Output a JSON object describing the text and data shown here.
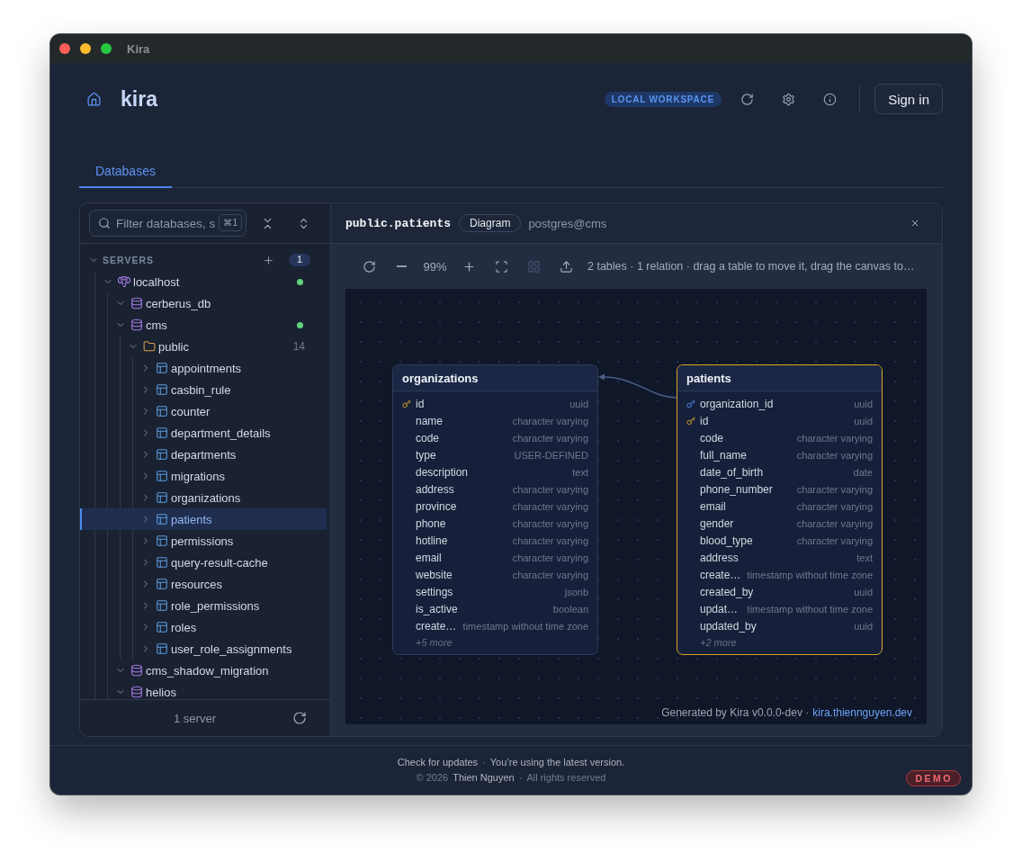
{
  "window": {
    "title": "Kira"
  },
  "header": {
    "brand": "kira",
    "badge": "LOCAL WORKSPACE",
    "sign_in": "Sign in"
  },
  "tabs": [
    {
      "label": "Databases",
      "selected": true
    }
  ],
  "sidebar": {
    "search": {
      "placeholder": "Filter databases, s",
      "shortcut": "⌘1"
    },
    "section": {
      "label": "SERVERS",
      "count": "1",
      "expanded": true
    },
    "tree": [
      {
        "kind": "server",
        "label": "localhost",
        "expanded": true,
        "connected": true,
        "selected": false,
        "children": [
          {
            "kind": "database",
            "label": "cerberus_db",
            "expanded": true,
            "connected": false,
            "selected": false
          },
          {
            "kind": "database",
            "label": "cms",
            "expanded": true,
            "connected": true,
            "selected": false,
            "children": [
              {
                "kind": "schema",
                "label": "public",
                "expanded": true,
                "selected": false,
                "count": "14",
                "children": [
                  {
                    "kind": "table",
                    "label": "appointments",
                    "expanded": false,
                    "selected": false
                  },
                  {
                    "kind": "table",
                    "label": "casbin_rule",
                    "expanded": false,
                    "selected": false
                  },
                  {
                    "kind": "table",
                    "label": "counter",
                    "expanded": false,
                    "selected": false
                  },
                  {
                    "kind": "table",
                    "label": "department_details",
                    "expanded": false,
                    "selected": false
                  },
                  {
                    "kind": "table",
                    "label": "departments",
                    "expanded": false,
                    "selected": false
                  },
                  {
                    "kind": "table",
                    "label": "migrations",
                    "expanded": false,
                    "selected": false
                  },
                  {
                    "kind": "table",
                    "label": "organizations",
                    "expanded": false,
                    "selected": false
                  },
                  {
                    "kind": "table",
                    "label": "patients",
                    "expanded": false,
                    "selected": true
                  },
                  {
                    "kind": "table",
                    "label": "permissions",
                    "expanded": false,
                    "selected": false
                  },
                  {
                    "kind": "table",
                    "label": "query-result-cache",
                    "expanded": false,
                    "selected": false
                  },
                  {
                    "kind": "table",
                    "label": "resources",
                    "expanded": false,
                    "selected": false
                  },
                  {
                    "kind": "table",
                    "label": "role_permissions",
                    "expanded": false,
                    "selected": false
                  },
                  {
                    "kind": "table",
                    "label": "roles",
                    "expanded": false,
                    "selected": false
                  },
                  {
                    "kind": "table",
                    "label": "user_role_assignments",
                    "expanded": false,
                    "selected": false
                  }
                ]
              }
            ]
          },
          {
            "kind": "database",
            "label": "cms_shadow_migration",
            "expanded": true,
            "connected": false,
            "selected": false
          },
          {
            "kind": "database",
            "label": "helios",
            "expanded": true,
            "connected": false,
            "selected": false
          }
        ]
      }
    ],
    "footer": "1 server"
  },
  "editor": {
    "title": "public.patients",
    "mode": "Diagram",
    "connection": "postgres@cms",
    "toolbar": [
      {
        "kind": "refresh",
        "disabled": false
      },
      {
        "kind": "zoom_out",
        "disabled": false
      },
      {
        "kind": "zoom_level",
        "label": "99%"
      },
      {
        "kind": "zoom_in",
        "disabled": false
      },
      {
        "kind": "fit",
        "disabled": false
      },
      {
        "kind": "layout",
        "disabled": true
      },
      {
        "kind": "export",
        "disabled": false
      },
      {
        "kind": "summary",
        "label": "2 tables · 1 relation · drag a table to move it, drag the canvas to…"
      }
    ],
    "diagram": {
      "tables": [
        {
          "name": "organizations",
          "selected": false,
          "columns": [
            {
              "kind": "primary",
              "name": "id",
              "type": "uuid"
            },
            {
              "kind": "plain",
              "name": "name",
              "type": "character varying"
            },
            {
              "kind": "plain",
              "name": "code",
              "type": "character varying"
            },
            {
              "kind": "plain",
              "name": "type",
              "type": "USER-DEFINED"
            },
            {
              "kind": "plain",
              "name": "description",
              "type": "text"
            },
            {
              "kind": "plain",
              "name": "address",
              "type": "character varying"
            },
            {
              "kind": "plain",
              "name": "province",
              "type": "character varying"
            },
            {
              "kind": "plain",
              "name": "phone",
              "type": "character varying"
            },
            {
              "kind": "plain",
              "name": "hotline",
              "type": "character varying"
            },
            {
              "kind": "plain",
              "name": "email",
              "type": "character varying"
            },
            {
              "kind": "plain",
              "name": "website",
              "type": "character varying"
            },
            {
              "kind": "plain",
              "name": "settings",
              "type": "jsonb"
            },
            {
              "kind": "plain",
              "name": "is_active",
              "type": "boolean"
            },
            {
              "kind": "plain",
              "name": "create…",
              "type": "timestamp without time zone"
            }
          ],
          "more": "+5 more"
        },
        {
          "name": "patients",
          "selected": true,
          "columns": [
            {
              "kind": "foreign",
              "name": "organization_id",
              "type": "uuid"
            },
            {
              "kind": "primary",
              "name": "id",
              "type": "uuid"
            },
            {
              "kind": "plain",
              "name": "code",
              "type": "character varying"
            },
            {
              "kind": "plain",
              "name": "full_name",
              "type": "character varying"
            },
            {
              "kind": "plain",
              "name": "date_of_birth",
              "type": "date"
            },
            {
              "kind": "plain",
              "name": "phone_number",
              "type": "character varying"
            },
            {
              "kind": "plain",
              "name": "email",
              "type": "character varying"
            },
            {
              "kind": "plain",
              "name": "gender",
              "type": "character varying"
            },
            {
              "kind": "plain",
              "name": "blood_type",
              "type": "character varying"
            },
            {
              "kind": "plain",
              "name": "address",
              "type": "text"
            },
            {
              "kind": "plain",
              "name": "create…",
              "type": "timestamp without time zone"
            },
            {
              "kind": "plain",
              "name": "created_by",
              "type": "uuid"
            },
            {
              "kind": "plain",
              "name": "updat…",
              "type": "timestamp without time zone"
            },
            {
              "kind": "plain",
              "name": "updated_by",
              "type": "uuid"
            }
          ],
          "more": "+2 more"
        }
      ],
      "credit": {
        "text": "Generated by Kira v0.0.0-dev ·",
        "link": "kira.thiennguyen.dev"
      }
    }
  },
  "footer": {
    "lines": [
      [
        {
          "kind": "link",
          "text": "Check for updates"
        },
        {
          "kind": "separator",
          "text": "·"
        },
        {
          "kind": "text",
          "text": "You’re using the latest version."
        }
      ],
      [
        {
          "kind": "muted",
          "text": "© 2026"
        },
        {
          "kind": "link",
          "text": "Thien Nguyen"
        },
        {
          "kind": "separator",
          "text": "·"
        },
        {
          "kind": "muted",
          "text": "All rights reserved"
        }
      ]
    ],
    "badge": "DEMO"
  }
}
